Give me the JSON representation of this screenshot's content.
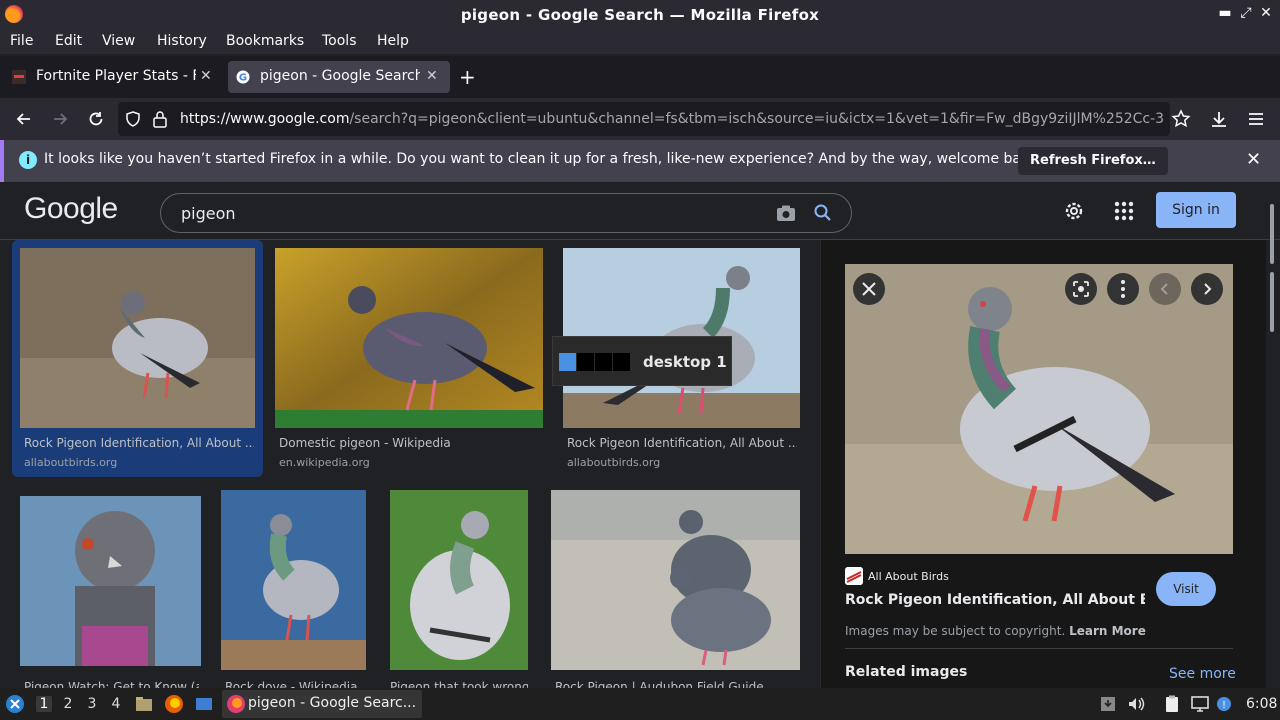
{
  "window": {
    "title": "pigeon - Google Search — Mozilla Firefox",
    "minimize": "▬",
    "restore": "⤢",
    "close": "✕"
  },
  "menubar": {
    "items": [
      {
        "label": "File"
      },
      {
        "label": "Edit"
      },
      {
        "label": "View"
      },
      {
        "label": "History"
      },
      {
        "label": "Bookmarks"
      },
      {
        "label": "Tools"
      },
      {
        "label": "Help"
      }
    ]
  },
  "tabs": [
    {
      "label": "Fortnite Player Stats - Fo",
      "active": false
    },
    {
      "label": "pigeon - Google Search",
      "active": true
    }
  ],
  "tab_close": "✕",
  "new_tab": "+",
  "navbar": {
    "url_domain": "https://www.google.com",
    "url_path": "/search?q=pigeon&client=ubuntu&channel=fs&tbm=isch&source=iu&ictx=1&vet=1&fir=Fw_dBgy9ziIJlM%252Cc-3"
  },
  "notification": {
    "message": "It looks like you haven’t started Firefox in a while. Do you want to clean it up for a fresh, like-new experience? And by the way, welcome back!",
    "button": "Refresh Firefox…",
    "info": "i",
    "close": "✕"
  },
  "google": {
    "logo": "Google",
    "query": "pigeon",
    "signin": "Sign in"
  },
  "results": [
    {
      "title": "Rock Pigeon Identification, All About ...",
      "source": "allaboutbirds.org"
    },
    {
      "title": "Domestic pigeon - Wikipedia",
      "source": "en.wikipedia.org"
    },
    {
      "title": "Rock Pigeon Identification, All About ...",
      "source": "allaboutbirds.org"
    },
    {
      "title": "Pigeon Watch: Get to Know (a",
      "source": ""
    },
    {
      "title": "Rock dove - Wikipedia",
      "source": ""
    },
    {
      "title": "Pigeon that took wrong",
      "source": ""
    },
    {
      "title": "Rock Pigeon | Audubon Field Guide",
      "source": ""
    }
  ],
  "panel": {
    "source": "All About Birds",
    "title": "Rock Pigeon Identification, All About Birds,...",
    "visit": "Visit",
    "copyright": "Images may be subject to copyright.",
    "learn_more": "Learn More",
    "related": "Related images",
    "see_more": "See more"
  },
  "desktop_tip": {
    "label": "desktop 1"
  },
  "taskbar": {
    "workspaces": [
      "1",
      "2",
      "3",
      "4"
    ],
    "task": "pigeon - Google Searc...",
    "clock": "6:08"
  }
}
